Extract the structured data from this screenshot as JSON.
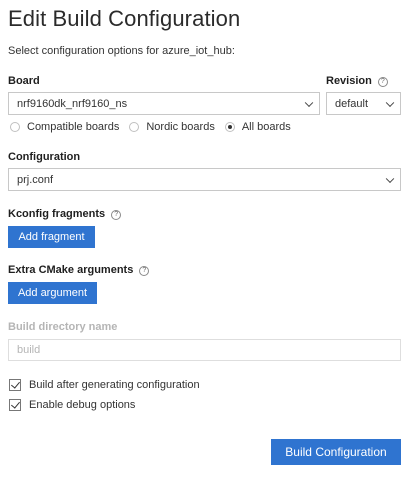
{
  "page": {
    "title": "Edit Build Configuration",
    "subtitle": "Select configuration options for azure_iot_hub:"
  },
  "board": {
    "label": "Board",
    "value": "nrf9160dk_nrf9160_ns",
    "icon": "chevron-down-icon"
  },
  "revision": {
    "label": "Revision",
    "help_icon": "?",
    "value": "default"
  },
  "board_filter": {
    "options": [
      {
        "label": "Compatible boards",
        "selected": false
      },
      {
        "label": "Nordic boards",
        "selected": false
      },
      {
        "label": "All boards",
        "selected": true
      }
    ]
  },
  "configuration": {
    "label": "Configuration",
    "value": "prj.conf"
  },
  "kconfig": {
    "label": "Kconfig fragments",
    "help_icon": "?",
    "button": "Add fragment"
  },
  "cmake": {
    "label": "Extra CMake arguments",
    "help_icon": "?",
    "button": "Add argument"
  },
  "build_dir": {
    "label": "Build directory name",
    "placeholder": "build"
  },
  "options": {
    "build_after": {
      "label": "Build after generating configuration",
      "checked": true
    },
    "debug": {
      "label": "Enable debug options",
      "checked": true
    }
  },
  "footer": {
    "primary_button": "Build Configuration"
  },
  "colors": {
    "accent": "#2f74d0"
  }
}
